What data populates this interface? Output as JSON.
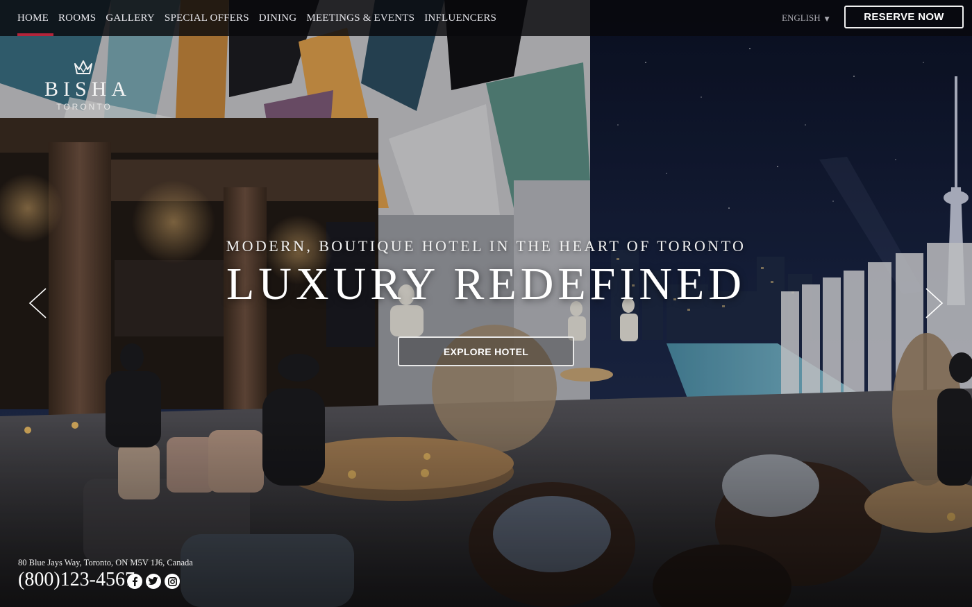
{
  "nav": {
    "items": [
      {
        "label": "HOME",
        "active": true
      },
      {
        "label": "ROOMS"
      },
      {
        "label": "GALLERY"
      },
      {
        "label": "SPECIAL OFFERS"
      },
      {
        "label": "DINING"
      },
      {
        "label": "MEETINGS & EVENTS"
      },
      {
        "label": "INFLUENCERS"
      }
    ],
    "language": "ENGLISH",
    "reserve_label": "RESERVE NOW"
  },
  "logo": {
    "brand": "BISHA",
    "city": "TORONTO"
  },
  "hero": {
    "tagline": "MODERN, BOUTIQUE HOTEL IN THE HEART OF TORONTO",
    "headline": "LUXURY REDEFINED",
    "cta_label": "EXPLORE HOTEL"
  },
  "footer": {
    "address": "80 Blue Jays Way, Toronto, ON M5V 1J6, Canada",
    "phone": "(800)123-4567",
    "social": [
      "facebook-icon",
      "twitter-icon",
      "instagram-icon"
    ]
  },
  "colors": {
    "accent": "#b3243a",
    "topbar": "#08080c",
    "night_sky": "#141b33"
  }
}
